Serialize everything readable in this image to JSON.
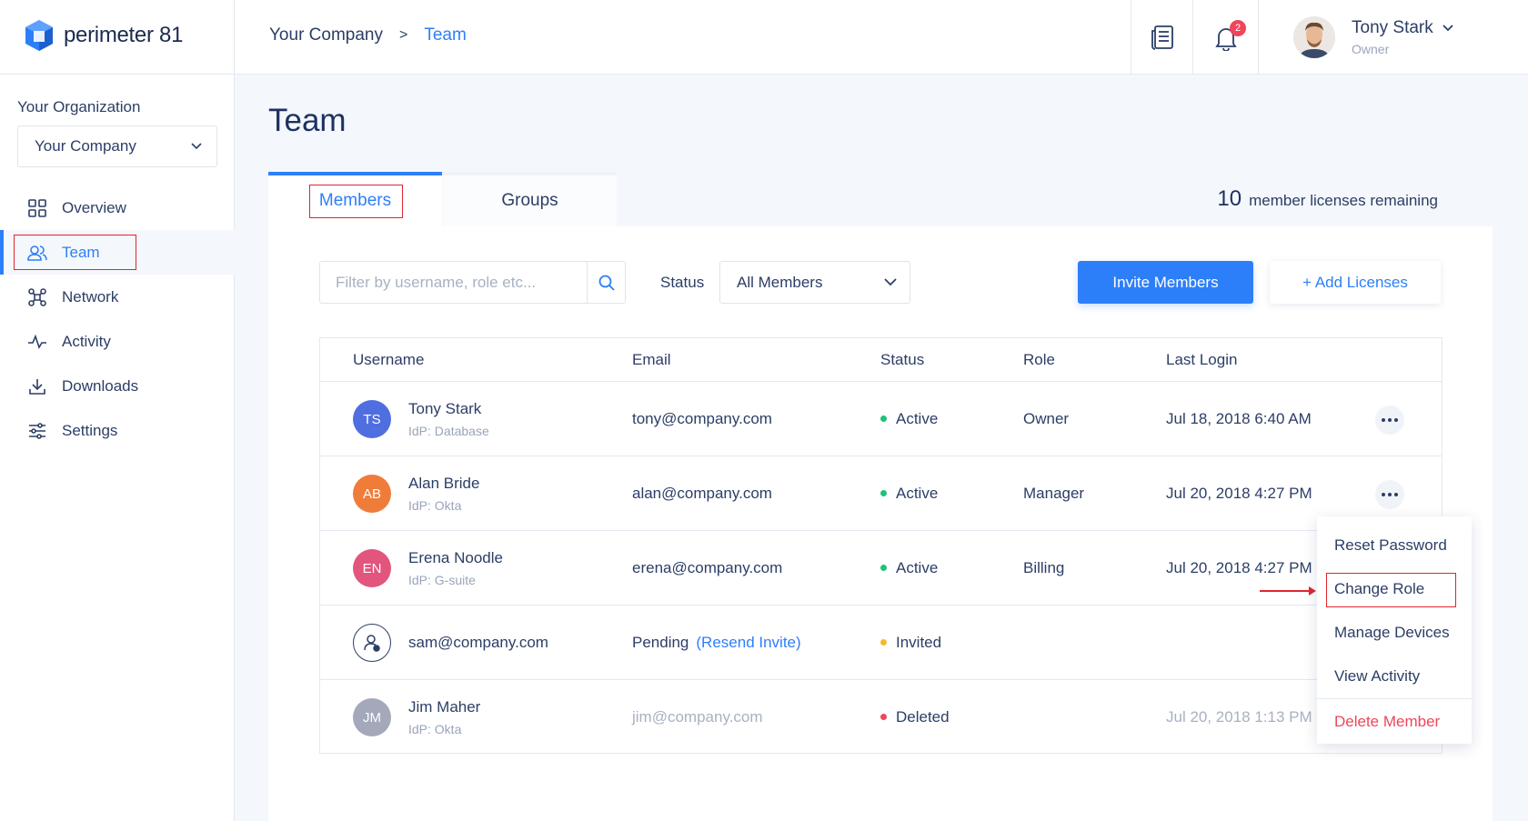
{
  "logo": {
    "text": "perimeter 81"
  },
  "breadcrumb": {
    "root": "Your Company",
    "separator": ">",
    "current": "Team"
  },
  "header": {
    "notifications_count": "2",
    "user": {
      "name": "Tony Stark",
      "role": "Owner"
    }
  },
  "sidebar": {
    "org_label": "Your Organization",
    "org_select": "Your Company",
    "items": [
      {
        "label": "Overview",
        "icon": "grid-icon"
      },
      {
        "label": "Team",
        "icon": "users-icon",
        "active": true
      },
      {
        "label": "Network",
        "icon": "network-icon"
      },
      {
        "label": "Activity",
        "icon": "pulse-icon"
      },
      {
        "label": "Downloads",
        "icon": "download-icon"
      },
      {
        "label": "Settings",
        "icon": "sliders-icon"
      }
    ]
  },
  "page": {
    "title": "Team"
  },
  "tabs": [
    {
      "label": "Members"
    },
    {
      "label": "Groups"
    }
  ],
  "licenses": {
    "count": "10",
    "text": "member licenses remaining"
  },
  "toolbar": {
    "filter_placeholder": "Filter by username, role etc...",
    "status_label": "Status",
    "status_value": "All Members",
    "invite_label": "Invite Members",
    "add_licenses_label": "+ Add Licenses"
  },
  "table": {
    "headers": [
      "Username",
      "Email",
      "Status",
      "Role",
      "Last Login"
    ],
    "rows": [
      {
        "initials": "TS",
        "name": "Tony Stark",
        "idp": "IdP: Database",
        "email": "tony@company.com",
        "status": "Active",
        "role": "Owner",
        "last_login": "Jul 18, 2018 6:40 AM"
      },
      {
        "initials": "AB",
        "name": "Alan Bride",
        "idp": "IdP: Okta",
        "email": "alan@company.com",
        "status": "Active",
        "role": "Manager",
        "last_login": "Jul 20, 2018 4:27 PM"
      },
      {
        "initials": "EN",
        "name": "Erena Noodle",
        "idp": "IdP: G-suite",
        "email": "erena@company.com",
        "status": "Active",
        "role": "Billing",
        "last_login": "Jul 20, 2018 4:27 PM"
      },
      {
        "name": "sam@company.com",
        "email": "Pending",
        "resend": "(Resend Invite)",
        "status": "Invited"
      },
      {
        "initials": "JM",
        "name": "Jim Maher",
        "idp": "IdP: Okta",
        "email": "jim@company.com",
        "status": "Deleted",
        "last_login": "Jul 20, 2018 1:13 PM"
      }
    ]
  },
  "menu": {
    "items": [
      "Reset Password",
      "Change Role",
      "Manage Devices",
      "View Activity",
      "Delete Member"
    ]
  },
  "colors": {
    "accent": "#2d7ff9",
    "active": "#1fc27a",
    "invited": "#f5b82e",
    "deleted": "#f0455a",
    "avatar_ts": "#4f6ee0",
    "avatar_ab": "#f07c3a",
    "avatar_en": "#e2557c",
    "avatar_jm": "#a3a9bb"
  }
}
